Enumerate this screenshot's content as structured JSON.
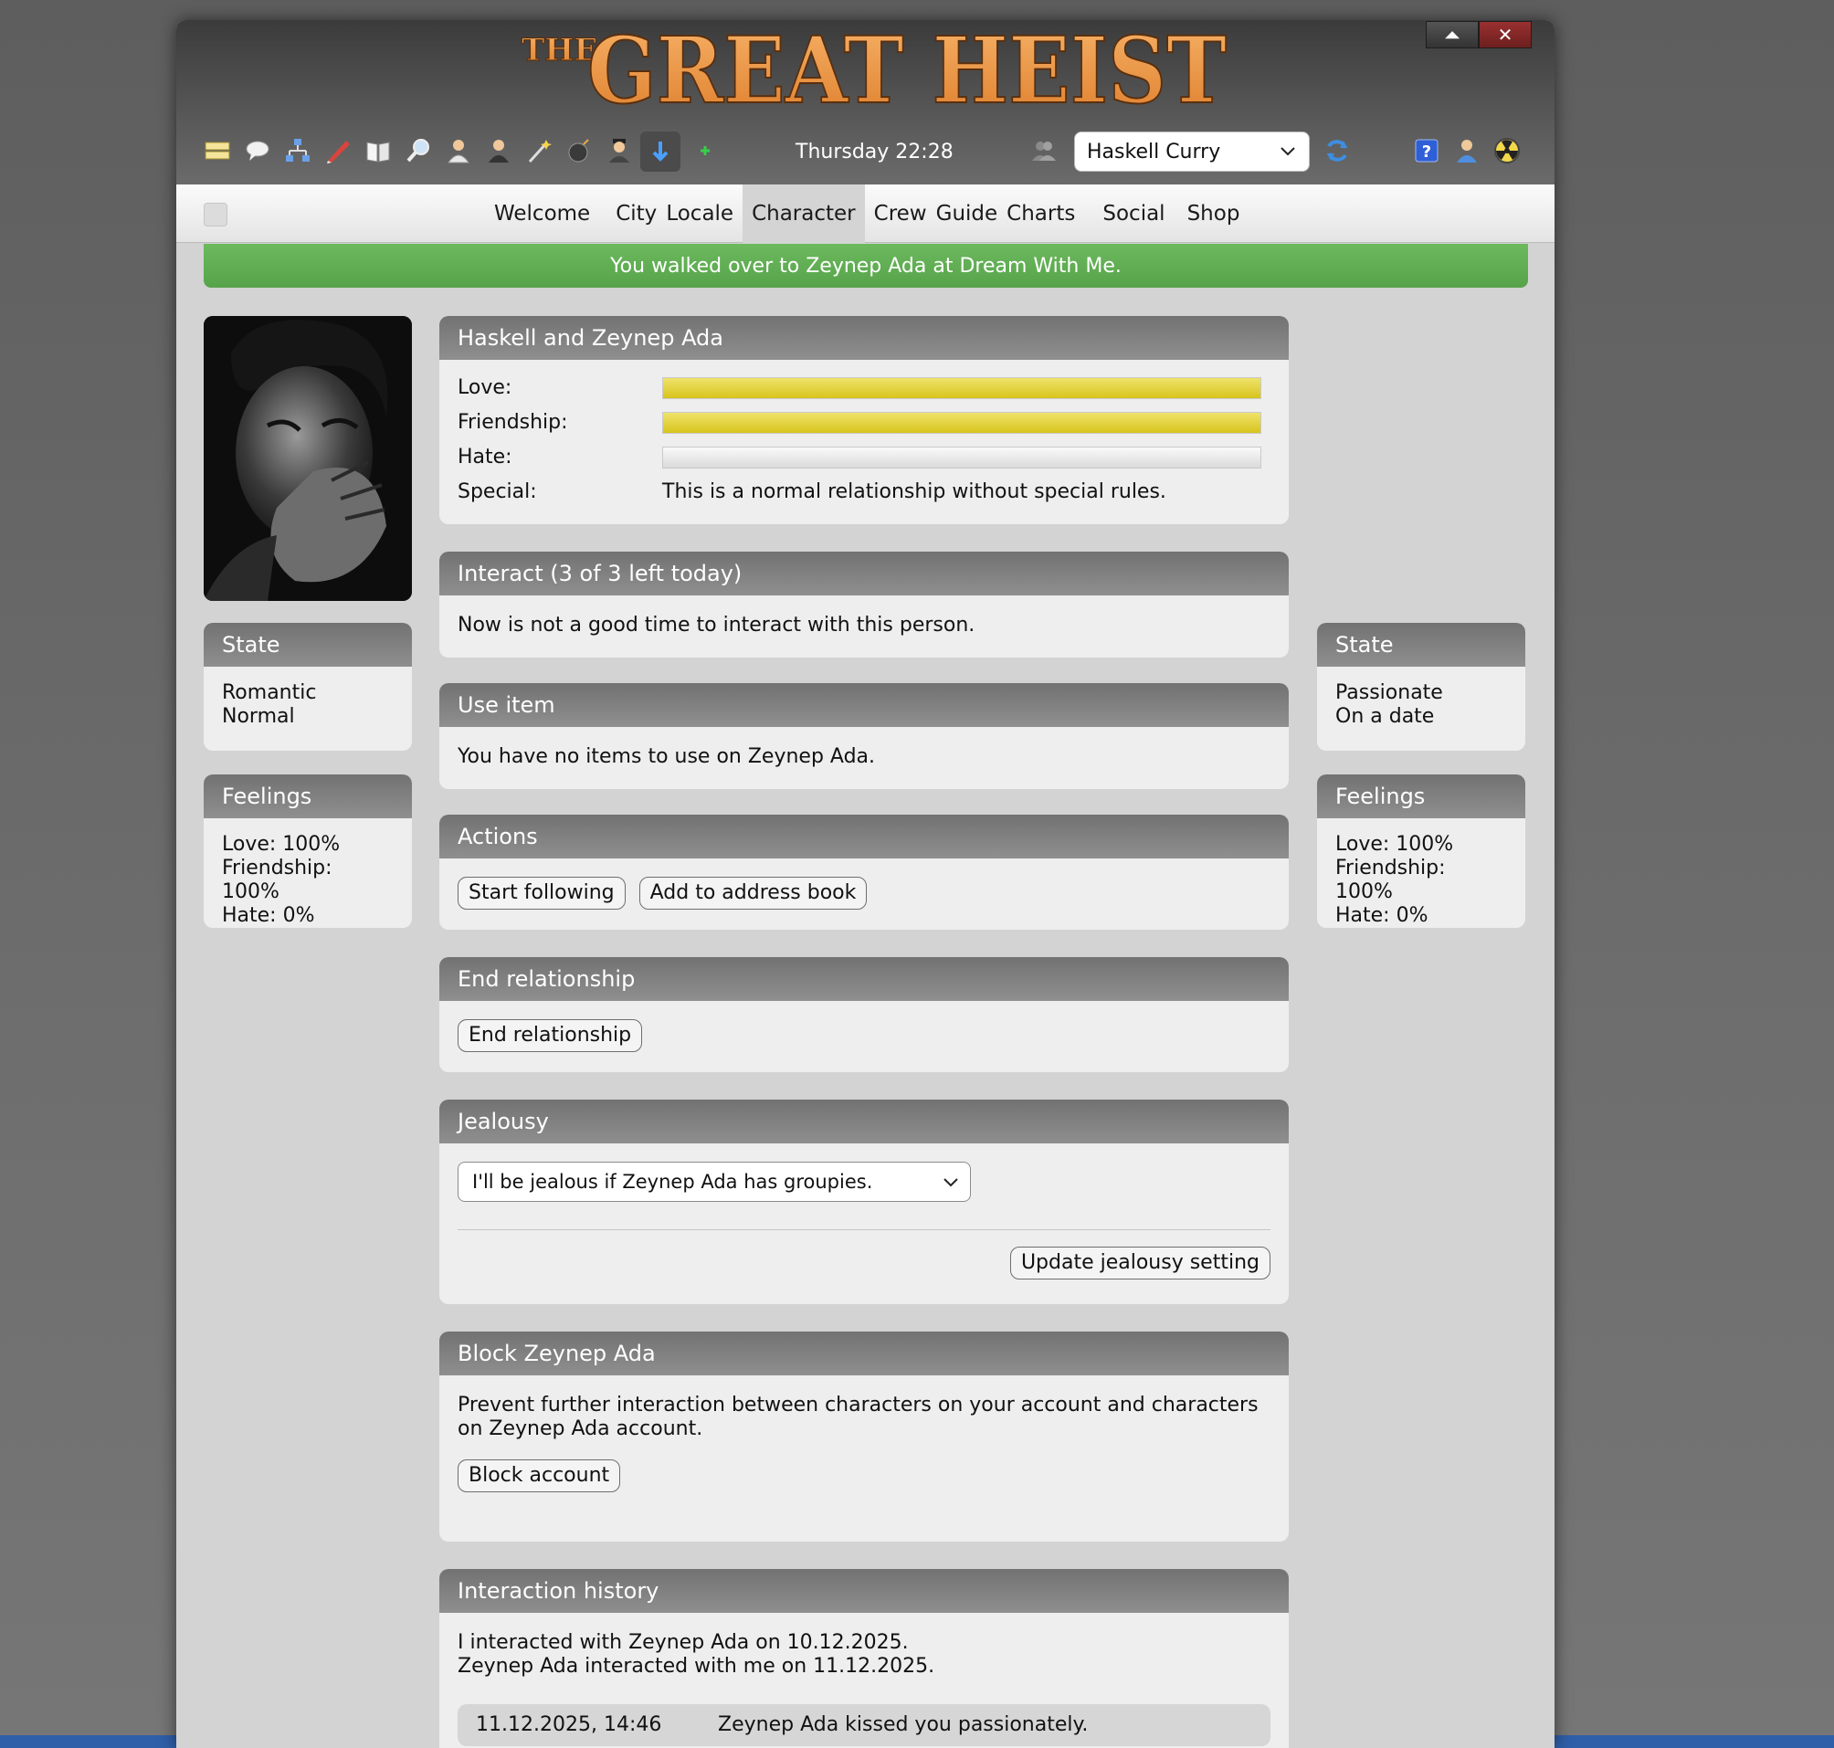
{
  "window": {
    "logo_small": "THE",
    "logo_big": "GREAT HEIST",
    "minimize_symbol": "⏶",
    "close_symbol": "✕"
  },
  "toolbar": {
    "icons": [
      "messages-icon",
      "chat-icon",
      "network-icon",
      "pencil-icon",
      "book-icon",
      "magnifier-icon",
      "person-icon",
      "agent-icon",
      "wand-icon",
      "bomb-icon",
      "suspect-icon",
      "download-icon",
      "plus-icon"
    ],
    "clock": "Thursday 22:28",
    "character_selected": "Haskell Curry",
    "right_icons": [
      "help-icon",
      "profile-icon",
      "radiation-icon"
    ]
  },
  "nav": {
    "items": [
      {
        "label": "Welcome",
        "active": false
      },
      {
        "label": "City",
        "active": false
      },
      {
        "label": "Locale",
        "active": false
      },
      {
        "label": "Character",
        "active": true
      },
      {
        "label": "Crew",
        "active": false
      },
      {
        "label": "Guide",
        "active": false
      },
      {
        "label": "Charts",
        "active": false
      },
      {
        "label": "Social",
        "active": false
      },
      {
        "label": "Shop",
        "active": false
      }
    ]
  },
  "notice": "You walked over to Zeynep Ada at Dream With Me.",
  "left": {
    "state_title": "State",
    "state_lines": [
      "Romantic",
      "Normal"
    ],
    "feelings_title": "Feelings",
    "feelings_lines": [
      "Love: 100%",
      "Friendship: 100%",
      "Hate: 0%"
    ]
  },
  "right": {
    "state_title": "State",
    "state_lines": [
      "Passionate",
      "On a date"
    ],
    "feelings_title": "Feelings",
    "feelings_lines": [
      "Love: 100%",
      "Friendship: 100%",
      "Hate: 0%"
    ]
  },
  "relationship": {
    "title": "Haskell and Zeynep Ada",
    "love_label": "Love:",
    "love_value": 1.0,
    "friendship_label": "Friendship:",
    "friendship_value": 1.0,
    "hate_label": "Hate:",
    "hate_value": 0.0,
    "special_label": "Special:",
    "special_text": "This is a normal relationship without special rules."
  },
  "interact": {
    "title": "Interact (3 of 3 left today)",
    "text": "Now is not a good time to interact with this person."
  },
  "use_item": {
    "title": "Use item",
    "text": "You have no items to use on Zeynep Ada."
  },
  "actions": {
    "title": "Actions",
    "follow_label": "Start following",
    "address_label": "Add to address book"
  },
  "end_relationship": {
    "title": "End relationship",
    "button_label": "End relationship"
  },
  "jealousy": {
    "title": "Jealousy",
    "selected": "I'll be jealous if Zeynep Ada has groupies.",
    "update_label": "Update jealousy setting"
  },
  "block": {
    "title": "Block Zeynep Ada",
    "text": "Prevent further interaction between characters on your account and characters on Zeynep Ada account.",
    "button_label": "Block account"
  },
  "history": {
    "title": "Interaction history",
    "line1": "I interacted with Zeynep Ada on 10.12.2025.",
    "line2": "Zeynep Ada interacted with me on 11.12.2025.",
    "entries": [
      {
        "date": "11.12.2025, 14:46",
        "text": "Zeynep Ada kissed you passionately."
      }
    ]
  },
  "colors": {
    "notice_green": "#5fac51",
    "bar_yellow": "#e1d03a",
    "panel_header": "#7f7f7f",
    "logo_orange": "#e9913f"
  }
}
